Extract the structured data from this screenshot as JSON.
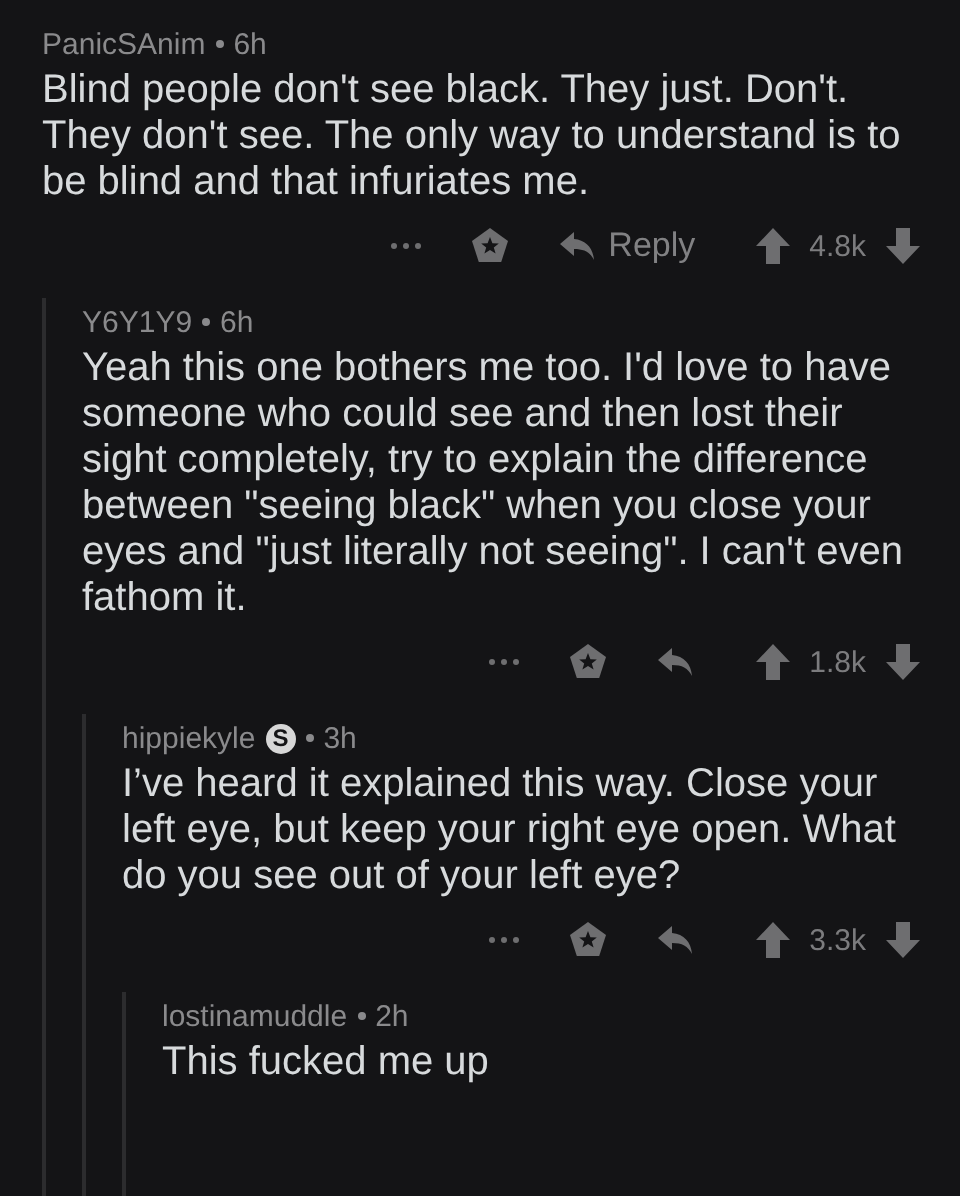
{
  "comments": [
    {
      "author": "PanicSAnim",
      "age": "6h",
      "body": "Blind people don't see black. They just. Don't. They don't see. The only way to understand is to be blind and that infuriates me.",
      "reply_label": "Reply",
      "score": "4.8k",
      "children": [
        {
          "author": "Y6Y1Y9",
          "age": "6h",
          "body": "Yeah this one bothers me too. I'd love to have someone who could see and then lost their sight completely, try to explain the difference between \"seeing black\" when you close your eyes and \"just literally not seeing\". I can't even fathom it.",
          "score": "1.8k",
          "children": [
            {
              "author": "hippiekyle",
              "flair": "S",
              "age": "3h",
              "body": "I’ve heard it explained this way. Close your left eye, but keep your right eye open. What do you see out of your left eye?",
              "score": "3.3k",
              "children": [
                {
                  "author": "lostinamuddle",
                  "age": "2h",
                  "body": "This fucked me up"
                }
              ]
            }
          ]
        }
      ]
    }
  ]
}
